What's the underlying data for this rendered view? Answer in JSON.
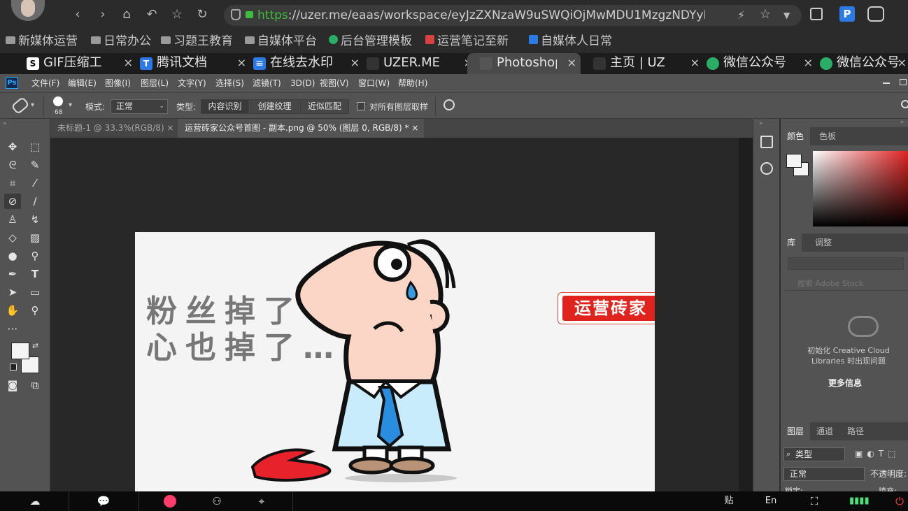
{
  "browser": {
    "url": "https://uzer.me/eaas/workspace/eyJzZXNzaW9uSWQiOjMwMDU1MzgzNDYyMTIzl",
    "url_scheme": "https",
    "url_rest": "://uzer.me/eaas/workspace/eyJzZXNzaW9uSWQiOjMwMDU1MzgzNDYyMTIzl",
    "bookmarks": [
      {
        "label": "新媒体运营"
      },
      {
        "label": "日常办公"
      },
      {
        "label": "习题王教育"
      },
      {
        "label": "自媒体平台"
      },
      {
        "label": "后台管理模板"
      },
      {
        "label": "运营笔记至新"
      },
      {
        "label": "自媒体人日常"
      }
    ],
    "tabs": [
      {
        "label": "GIF压缩工",
        "close": "×",
        "fav_color": "#ffffff",
        "fav_text": "S"
      },
      {
        "label": "腾讯文档",
        "close": "×",
        "fav_color": "#2c7be5",
        "fav_text": "T"
      },
      {
        "label": "在线去水印",
        "close": "×",
        "fav_color": "#2c7be5",
        "fav_text": "≡"
      },
      {
        "label": "UZER.ME",
        "close": "×",
        "fav_color": "#3a3a3a",
        "fav_text": "·"
      },
      {
        "label": "Photoshop",
        "close": "×",
        "fav_color": "#3a3a3a",
        "fav_text": "·",
        "active": true
      },
      {
        "label": "主页 | UZ",
        "close": "×",
        "fav_color": "#3a3a3a",
        "fav_text": "·"
      },
      {
        "label": "微信公众号",
        "close": "×",
        "fav_color": "#2aae67",
        "fav_text": "●"
      },
      {
        "label": "微信公众号",
        "close": "×",
        "fav_color": "#2aae67",
        "fav_text": "●"
      }
    ]
  },
  "ps": {
    "logo": "Ps",
    "menu": [
      "文件(F)",
      "编辑(E)",
      "图像(I)",
      "图层(L)",
      "文字(Y)",
      "选择(S)",
      "滤镜(T)",
      "3D(D)",
      "视图(V)",
      "窗口(W)",
      "帮助(H)"
    ],
    "options": {
      "brush_size": "68",
      "mode_label": "模式:",
      "mode_value": "正常",
      "type_label": "类型:",
      "type_options": [
        "内容识别",
        "创建纹理",
        "近似匹配"
      ],
      "sample_all_label": "对所有图层取样"
    },
    "doc_tabs": [
      {
        "label": "未标题-1 @ 33.3%(RGB/8)",
        "close": "×",
        "active": false
      },
      {
        "label": "运营砖家公众号首图 - 副本.png @ 50% (图层 0, RGB/8) *",
        "close": "×",
        "active": true
      }
    ],
    "canvas": {
      "line1": "粉丝掉了",
      "line2": "心也掉了…",
      "brand": "运营砖家"
    },
    "panels": {
      "color_tabs": [
        "颜色",
        "色板"
      ],
      "library_tabs": [
        "库",
        "调整"
      ],
      "library_search_placeholder": "搜索 Adobe Stock",
      "library_msg": "初始化 Creative Cloud Libraries 时出现问题",
      "library_more": "更多信息",
      "layers_tabs": [
        "图层",
        "通道",
        "路径"
      ],
      "layers_kind": "类型",
      "blend_mode": "正常",
      "opacity_label": "不透明度:",
      "lock_label": "锁定:",
      "fill_label": "填充:"
    }
  },
  "taskbar": {
    "paste_label": "贴",
    "lang_label": "En"
  }
}
